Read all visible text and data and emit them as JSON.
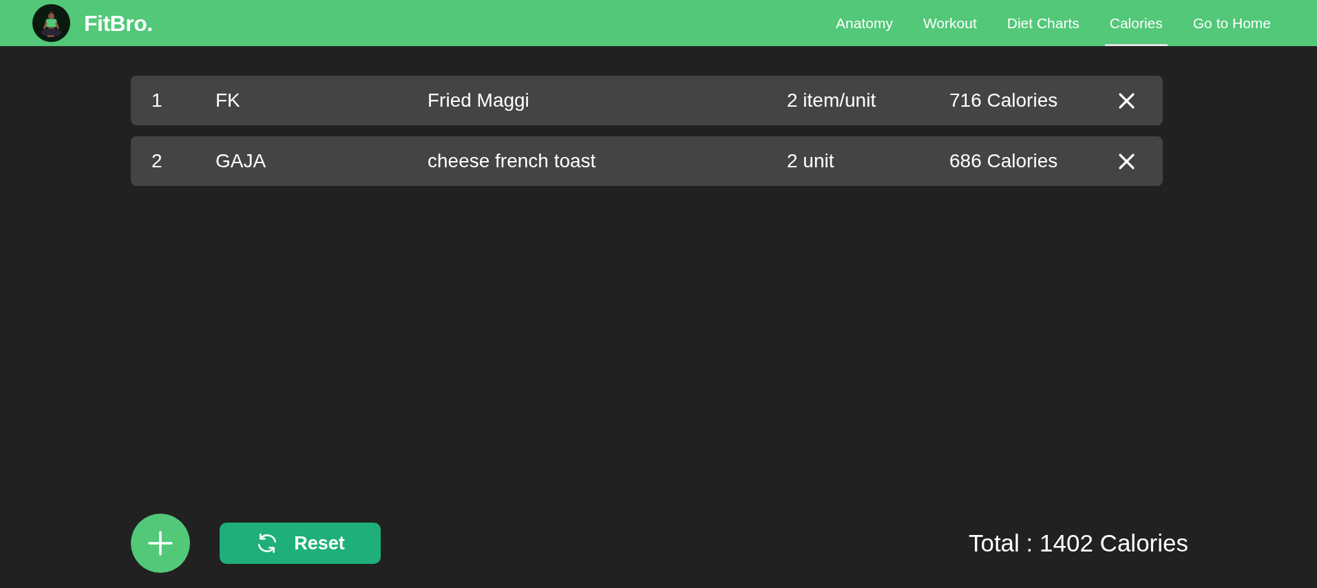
{
  "navbar": {
    "brand": "FitBro.",
    "links": [
      {
        "label": "Anatomy",
        "selected": false
      },
      {
        "label": "Workout",
        "selected": false
      },
      {
        "label": "Diet Charts",
        "selected": false
      },
      {
        "label": "Calories",
        "selected": true
      },
      {
        "label": "Go to Home",
        "selected": false
      }
    ]
  },
  "entries": [
    {
      "index": "1",
      "name": "FK",
      "food": "Fried Maggi",
      "quantity": "2 item/unit",
      "calories": "716 Calories"
    },
    {
      "index": "2",
      "name": "GAJA",
      "food": "cheese french toast",
      "quantity": "2 unit",
      "calories": "686 Calories"
    }
  ],
  "actions": {
    "reset_label": "Reset"
  },
  "total": "Total : 1402 Calories"
}
